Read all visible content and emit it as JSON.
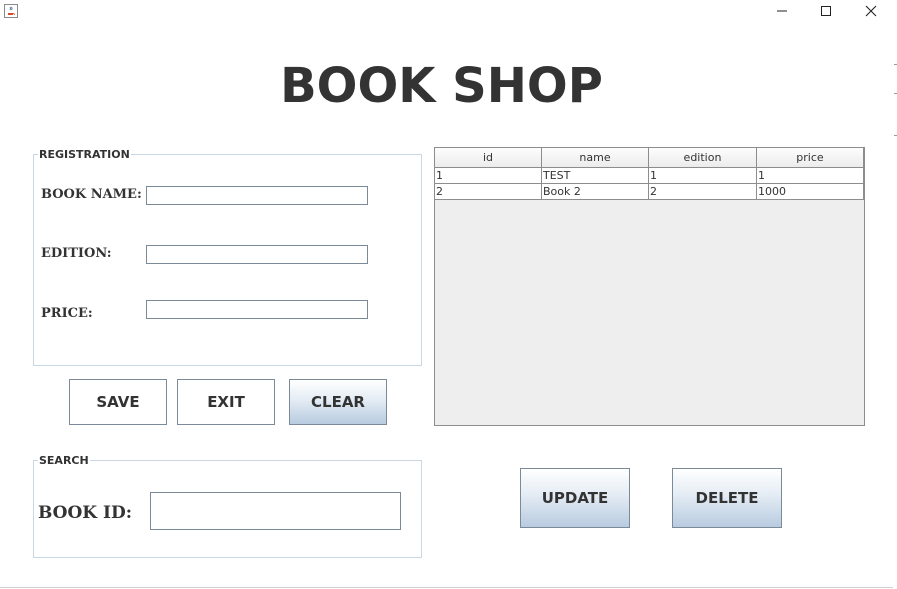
{
  "window": {
    "icon": "java-cup-icon",
    "controls": [
      "minimize-icon",
      "maximize-icon",
      "close-icon"
    ]
  },
  "title": "BOOK SHOP",
  "registration": {
    "legend": "REGISTRATION",
    "book_name_label": "BOOK NAME:",
    "book_name_value": "",
    "edition_label": "EDITION:",
    "edition_value": "",
    "price_label": "PRICE:",
    "price_value": ""
  },
  "buttons": {
    "save": "SAVE",
    "exit": "EXIT",
    "clear": "CLEAR",
    "update": "UPDATE",
    "delete": "DELETE"
  },
  "search": {
    "legend": "SEARCH",
    "book_id_label": "BOOK ID:",
    "book_id_value": ""
  },
  "table": {
    "columns": [
      "id",
      "name",
      "edition",
      "price"
    ],
    "rows": [
      [
        "1",
        "TEST",
        "1",
        "1"
      ],
      [
        "2",
        "Book 2",
        "2",
        "1000"
      ]
    ]
  }
}
